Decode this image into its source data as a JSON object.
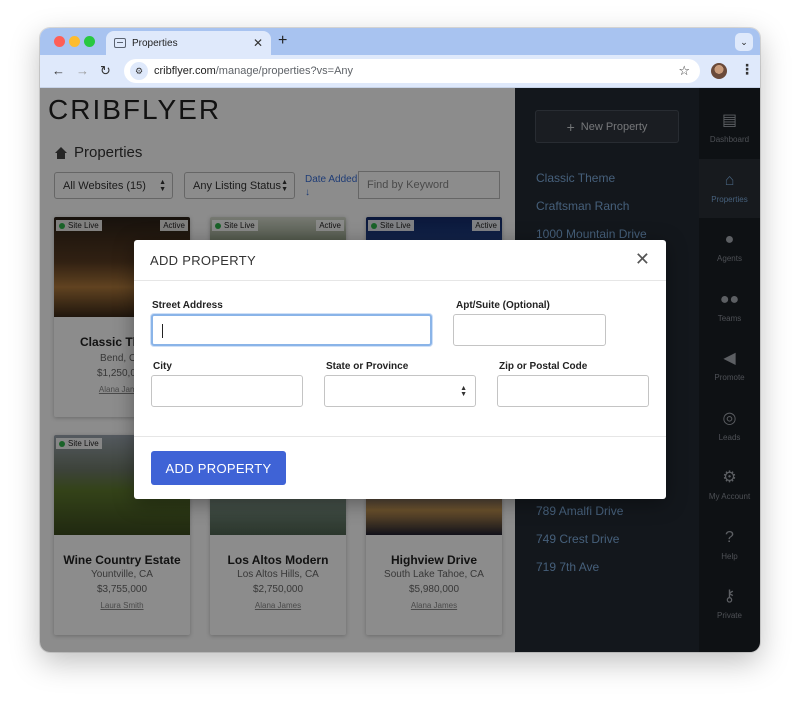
{
  "browser": {
    "tab_title": "Properties",
    "tab_close": "✕",
    "new_tab": "+",
    "dropdown": "⌄",
    "url_host": "cribflyer.com",
    "url_path": "/manage/properties?vs=Any",
    "icons": [
      "back-icon",
      "forward-icon",
      "reload-icon",
      "site-info-icon",
      "star-icon",
      "kebab-menu-icon"
    ]
  },
  "page": {
    "logo": "CRIBFLYER",
    "heading": "Properties",
    "filters": {
      "websites": "All Websites (15)",
      "status": "Any Listing Status",
      "sort_label": "Date Added",
      "sort_arrow": "↓",
      "search_placeholder": "Find by Keyword"
    },
    "badges": {
      "live": "Site Live",
      "active": "Active"
    },
    "cards": [
      {
        "name": "Classic Theme",
        "location": "Bend, OR",
        "price": "$1,250,000",
        "agent": "Alana James",
        "image": "img-interior"
      },
      {
        "name": "",
        "location": "",
        "price": "",
        "agent": "",
        "image": "img-forest"
      },
      {
        "name": "",
        "location": "",
        "price": "",
        "agent": "",
        "image": "img-night"
      },
      {
        "name": "Wine Country Estate",
        "location": "Yountville, CA",
        "price": "$3,755,000",
        "agent": "Laura Smith",
        "image": "img-vineyard"
      },
      {
        "name": "Los Altos Modern",
        "location": "Los Altos Hills, CA",
        "price": "$2,750,000",
        "agent": "Alana James",
        "image": "img-lake"
      },
      {
        "name": "Highview Drive",
        "location": "South Lake Tahoe, CA",
        "price": "$5,980,000",
        "agent": "Alana James",
        "image": "img-lodge"
      }
    ]
  },
  "panel": {
    "new_property": "New Property",
    "links": [
      "Classic Theme",
      "Craftsman Ranch",
      "1000 Mountain Drive",
      "789 Amalfi Drive",
      "749 Crest Drive",
      "719 7th Ave"
    ]
  },
  "sidebar": {
    "items": [
      {
        "label": "Dashboard",
        "icon": "dashboard-icon",
        "glyph": "▤"
      },
      {
        "label": "Properties",
        "icon": "properties-icon",
        "glyph": "⌂"
      },
      {
        "label": "Agents",
        "icon": "agent-icon",
        "glyph": "●"
      },
      {
        "label": "Teams",
        "icon": "teams-icon",
        "glyph": "●●"
      },
      {
        "label": "Promote",
        "icon": "megaphone-icon",
        "glyph": "◀"
      },
      {
        "label": "Leads",
        "icon": "target-icon",
        "glyph": "◎"
      },
      {
        "label": "My Account",
        "icon": "gear-icon",
        "glyph": "⚙"
      },
      {
        "label": "Help",
        "icon": "help-icon",
        "glyph": "?"
      },
      {
        "label": "Private",
        "icon": "key-icon",
        "glyph": "⚷"
      }
    ]
  },
  "modal": {
    "title": "ADD PROPERTY",
    "close": "✕",
    "street_label": "Street Address",
    "street_value": "",
    "apt_label": "Apt/Suite (Optional)",
    "apt_value": "",
    "city_label": "City",
    "city_value": "",
    "state_label": "State or Province",
    "state_value": "",
    "zip_label": "Zip or Postal Code",
    "zip_value": "",
    "submit": "ADD PROPERTY"
  },
  "colors": {
    "accent": "#3f63d6",
    "panel_link": "#7faedf",
    "live_dot": "#2fb24a"
  }
}
